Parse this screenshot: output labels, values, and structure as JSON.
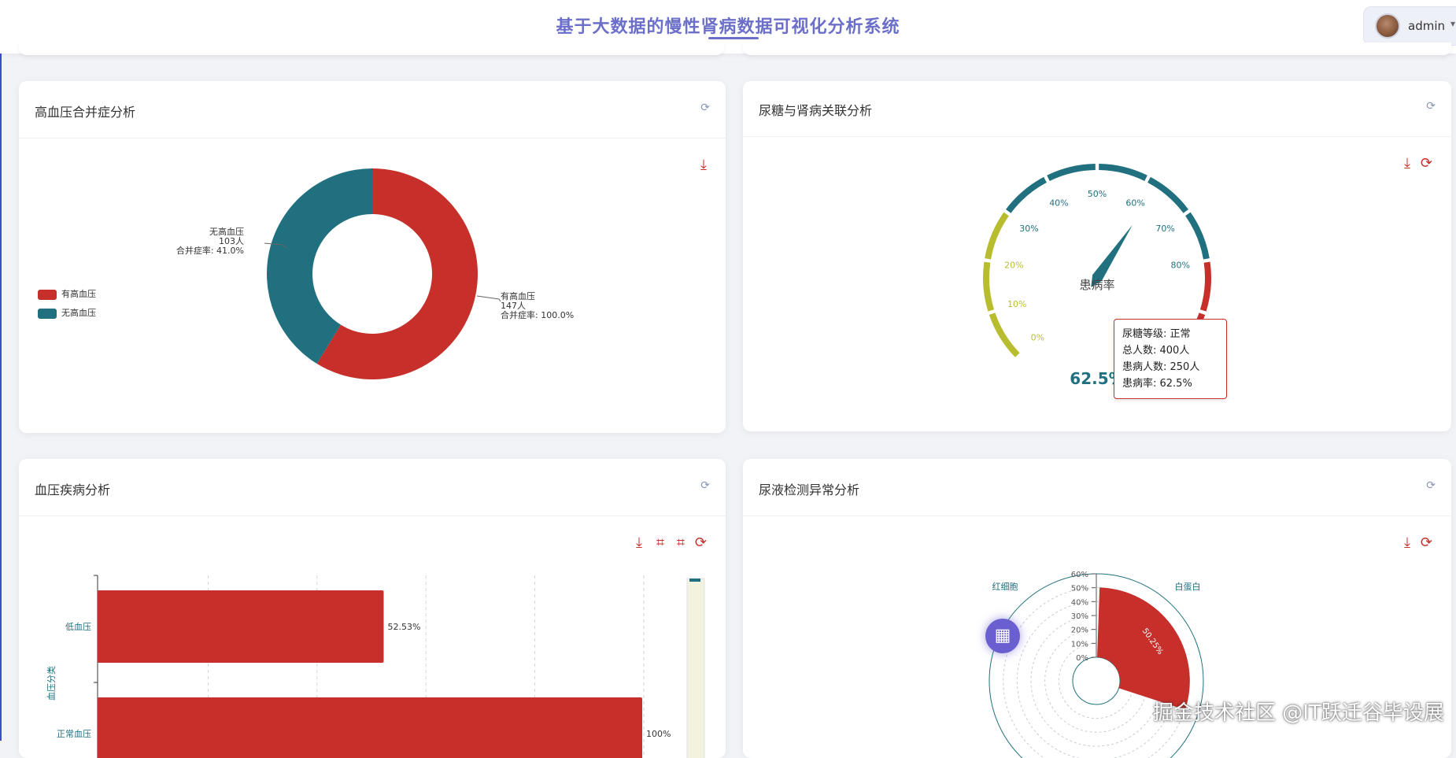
{
  "header": {
    "title": "基于大数据的慢性肾病数据可视化分析系统",
    "username": "admin"
  },
  "cards": {
    "hypertension": {
      "title": "高血压合并症分析",
      "legend": [
        {
          "label": "有高血压",
          "color": "#c62f2a"
        },
        {
          "label": "无高血压",
          "color": "#21707f"
        }
      ],
      "labels": [
        {
          "name": "有高血压",
          "count": "147人",
          "rate": "合并症率: 100.0%"
        },
        {
          "name": "无高血压",
          "count": "103人",
          "rate": "合并症率: 41.0%"
        }
      ]
    },
    "glucose": {
      "title": "尿糖与肾病关联分析",
      "gauge_name": "患病率",
      "value_label": "62.5%",
      "tooltip": {
        "line1": "尿糖等级: 正常",
        "line2": "总人数: 400人",
        "line3": "患病人数: 250人",
        "line4": "患病率: 62.5%"
      }
    },
    "bp": {
      "title": "血压疾病分析"
    },
    "urine": {
      "title": "尿液检测异常分析"
    }
  },
  "chart_data": [
    {
      "type": "pie",
      "variant": "donut",
      "series": [
        {
          "name": "有高血压",
          "value": 147,
          "color": "#c62f2a"
        },
        {
          "name": "无高血压",
          "value": 103,
          "color": "#21707f"
        }
      ]
    },
    {
      "type": "gauge",
      "name": "患病率",
      "value": 62.5,
      "min": 0,
      "max": 100,
      "ticks": [
        "0%",
        "10%",
        "20%",
        "30%",
        "40%",
        "50%",
        "60%",
        "70%",
        "80%"
      ],
      "color_bands": [
        {
          "to": 0.3,
          "color": "#b8bd2f"
        },
        {
          "to": 0.8,
          "color": "#21707f"
        },
        {
          "to": 1.0,
          "color": "#c62f2a"
        }
      ]
    },
    {
      "type": "bar",
      "orientation": "horizontal",
      "ylabel": "血压分类",
      "categories": [
        "低血压",
        "正常血压"
      ],
      "values": [
        52.53,
        100
      ],
      "value_labels": [
        "52.53%",
        "100%"
      ],
      "xlim": [
        0,
        100
      ],
      "grid": true
    },
    {
      "type": "polar-bar",
      "categories": [
        "白蛋白",
        "红细胞"
      ],
      "values": [
        50.25,
        0
      ],
      "value_labels": [
        "50.25%"
      ],
      "radial_ticks": [
        "0%",
        "10%",
        "20%",
        "30%",
        "40%",
        "50%",
        "60%"
      ],
      "rmax": 60
    }
  ],
  "icons": {
    "download": "download-icon",
    "refresh": "refresh-icon",
    "zoom": "zoom-icon",
    "grid": "grid-icon"
  },
  "watermark": "掘金技术社区 @IT跃迁谷毕设展"
}
